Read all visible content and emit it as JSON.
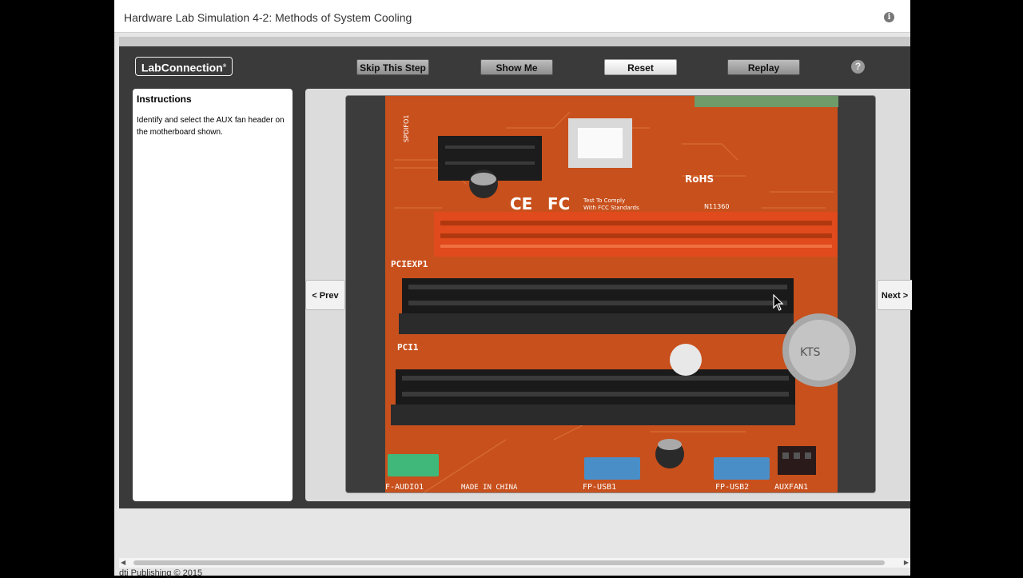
{
  "window": {
    "title": "Hardware Lab Simulation 4-2: Methods of System Cooling",
    "info_icon": "info-icon"
  },
  "toolbar": {
    "logo_text": "LabConnection",
    "logo_mark": "®",
    "skip_label": "Skip This Step",
    "show_label": "Show Me",
    "reset_label": "Reset",
    "replay_label": "Replay",
    "help_label": "?"
  },
  "instructions": {
    "heading": "Instructions",
    "text": "Identify and select the AUX fan header on the motherboard shown."
  },
  "viewer": {
    "prev_label": "< Prev",
    "next_label": "Next >",
    "board_labels": {
      "spdif": "SPDIFO1",
      "rohs": "RoHS",
      "ce": "CE",
      "fc": "FC",
      "fcc_text_1": "Test To Comply",
      "fcc_text_2": "With FCC Standards",
      "cert": "N11360",
      "pciexp": "PCIEXP1",
      "pci": "PCI1",
      "audio": "F-AUDIO1",
      "made": "MADE IN CHINA",
      "usb1": "FP-USB1",
      "usb2": "FP-USB2",
      "auxfan": "AUXFAN1",
      "battery": "KTS"
    }
  },
  "footer": {
    "text": "dti Publishing © 2015"
  },
  "colors": {
    "board": "#c8501c",
    "slot_red": "#e04a1c",
    "header_blue": "#4a8ec8",
    "header_green": "#3fb87a"
  }
}
